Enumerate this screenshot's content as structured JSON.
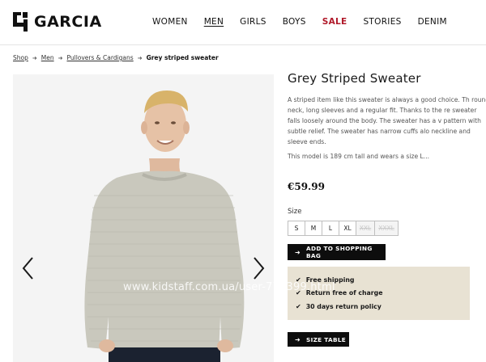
{
  "brand": {
    "name": "GARCIA",
    "logo_icon": "garcia-g-mark"
  },
  "nav": {
    "items": [
      {
        "label": "WOMEN",
        "state": "normal"
      },
      {
        "label": "MEN",
        "state": "active"
      },
      {
        "label": "GIRLS",
        "state": "normal"
      },
      {
        "label": "BOYS",
        "state": "normal"
      },
      {
        "label": "SALE",
        "state": "sale"
      },
      {
        "label": "STORIES",
        "state": "normal"
      },
      {
        "label": "DENIM",
        "state": "normal"
      }
    ],
    "sale_color": "#b0192a"
  },
  "breadcrumb": {
    "items": [
      "Shop",
      "Men",
      "Pullovers & Cardigans"
    ],
    "current": "Grey striped sweater",
    "separator_icon": "arrow-right-icon"
  },
  "product": {
    "title": "Grey Striped Sweater",
    "description": "A striped item like this sweater is always a good choice. Th round neck, long sleeves and a regular fit. Thanks to the re sweater falls loosely around the body. The sweater has a v pattern with subtle relief. The sweater has narrow cuffs alo neckline and sleeve ends.",
    "model_note": "This model is 189 cm tall and wears a size L...",
    "price": "€59.99",
    "size_label": "Size",
    "sizes": [
      {
        "label": "S",
        "available": true
      },
      {
        "label": "M",
        "available": true
      },
      {
        "label": "L",
        "available": true
      },
      {
        "label": "XL",
        "available": true
      },
      {
        "label": "XXL",
        "available": false
      },
      {
        "label": "XXXL",
        "available": false
      }
    ],
    "add_to_bag_label": "ADD TO SHOPPING BAG",
    "size_table_label": "SIZE TABLE",
    "benefits": [
      "Free shipping",
      "Return free of charge",
      "30 days return policy"
    ],
    "benefits_bg": "#e8e2d3"
  },
  "gallery": {
    "prev_icon": "chevron-left-icon",
    "next_icon": "chevron-right-icon",
    "watermark": "www.kidstaff.com.ua/user-776399.html"
  }
}
